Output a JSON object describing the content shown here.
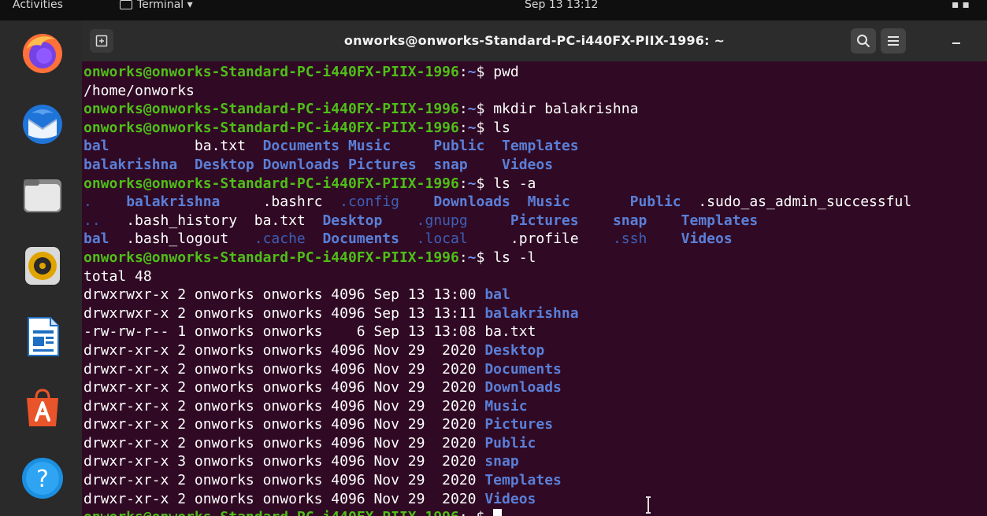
{
  "topbar": {
    "activities": "Activities",
    "app_name": "Terminal ▾",
    "clock": "Sep 13  13:12"
  },
  "window": {
    "title": "onworks@onworks-Standard-PC-i440FX-PIIX-1996: ~"
  },
  "dock": {
    "items": [
      "firefox",
      "thunderbird",
      "files",
      "rhythmbox",
      "libreoffice-writer",
      "software",
      "help"
    ]
  },
  "colors": {
    "terminal_bg": "#300a24",
    "prompt": "#4fbe18",
    "directory": "#5a7fd8",
    "header_bg": "#2c2c2c",
    "dock_bg": "#2a2a2a"
  },
  "terminal": {
    "prompt_user": "onworks@onworks-Standard-PC-i440FX-PIIX-1996",
    "prompt_sep": ":",
    "prompt_path": "~",
    "prompt_dollar": "$",
    "lines": [
      {
        "kind": "prompt",
        "cmd": " pwd"
      },
      {
        "kind": "out",
        "text": "/home/onworks"
      },
      {
        "kind": "prompt",
        "cmd": " mkdir balakrishna"
      },
      {
        "kind": "prompt",
        "cmd": " ls"
      },
      {
        "kind": "cols",
        "cells": [
          {
            "t": "bal          ",
            "c": "dir"
          },
          {
            "t": "ba.txt  ",
            "c": "file"
          },
          {
            "t": "Documents ",
            "c": "dir"
          },
          {
            "t": "Music     ",
            "c": "dir"
          },
          {
            "t": "Public  ",
            "c": "dir"
          },
          {
            "t": "Templates",
            "c": "dir"
          }
        ]
      },
      {
        "kind": "cols",
        "cells": [
          {
            "t": "balakrishna  ",
            "c": "dir"
          },
          {
            "t": "Desktop ",
            "c": "dir"
          },
          {
            "t": "Downloads ",
            "c": "dir"
          },
          {
            "t": "Pictures  ",
            "c": "dir"
          },
          {
            "t": "snap    ",
            "c": "dir"
          },
          {
            "t": "Videos",
            "c": "dir"
          }
        ]
      },
      {
        "kind": "prompt",
        "cmd": " ls -a"
      },
      {
        "kind": "cols",
        "cells": [
          {
            "t": ".    ",
            "c": "dotdir"
          },
          {
            "t": "balakrishna     ",
            "c": "dir"
          },
          {
            "t": ".bashrc  ",
            "c": "file"
          },
          {
            "t": ".config    ",
            "c": "dotdir"
          },
          {
            "t": "Downloads  ",
            "c": "dir"
          },
          {
            "t": "Music       ",
            "c": "dir"
          },
          {
            "t": "Public  ",
            "c": "dir"
          },
          {
            "t": ".sudo_as_admin_successful",
            "c": "file"
          }
        ]
      },
      {
        "kind": "cols",
        "cells": [
          {
            "t": "..   ",
            "c": "dotdir"
          },
          {
            "t": ".bash_history  ",
            "c": "file"
          },
          {
            "t": "ba.txt  ",
            "c": "file"
          },
          {
            "t": "Desktop    ",
            "c": "dir"
          },
          {
            "t": ".gnupg     ",
            "c": "dotdir"
          },
          {
            "t": "Pictures    ",
            "c": "dir"
          },
          {
            "t": "snap    ",
            "c": "dir"
          },
          {
            "t": "Templates",
            "c": "dir"
          }
        ]
      },
      {
        "kind": "cols",
        "cells": [
          {
            "t": "bal  ",
            "c": "dir"
          },
          {
            "t": ".bash_logout   ",
            "c": "file"
          },
          {
            "t": ".cache  ",
            "c": "dotdir"
          },
          {
            "t": "Documents  ",
            "c": "dir"
          },
          {
            "t": ".local     ",
            "c": "dotdir"
          },
          {
            "t": ".profile    ",
            "c": "file"
          },
          {
            "t": ".ssh    ",
            "c": "dotdir"
          },
          {
            "t": "Videos",
            "c": "dir"
          }
        ]
      },
      {
        "kind": "prompt",
        "cmd": " ls -l"
      },
      {
        "kind": "out",
        "text": "total 48"
      },
      {
        "kind": "ll",
        "meta": "drwxrwxr-x 2 onworks onworks 4096 Sep 13 13:00 ",
        "name": "bal",
        "c": "dir"
      },
      {
        "kind": "ll",
        "meta": "drwxrwxr-x 2 onworks onworks 4096 Sep 13 13:11 ",
        "name": "balakrishna",
        "c": "dir"
      },
      {
        "kind": "ll",
        "meta": "-rw-rw-r-- 1 onworks onworks    6 Sep 13 13:08 ",
        "name": "ba.txt",
        "c": "file"
      },
      {
        "kind": "ll",
        "meta": "drwxr-xr-x 2 onworks onworks 4096 Nov 29  2020 ",
        "name": "Desktop",
        "c": "dir"
      },
      {
        "kind": "ll",
        "meta": "drwxr-xr-x 2 onworks onworks 4096 Nov 29  2020 ",
        "name": "Documents",
        "c": "dir"
      },
      {
        "kind": "ll",
        "meta": "drwxr-xr-x 2 onworks onworks 4096 Nov 29  2020 ",
        "name": "Downloads",
        "c": "dir"
      },
      {
        "kind": "ll",
        "meta": "drwxr-xr-x 2 onworks onworks 4096 Nov 29  2020 ",
        "name": "Music",
        "c": "dir"
      },
      {
        "kind": "ll",
        "meta": "drwxr-xr-x 2 onworks onworks 4096 Nov 29  2020 ",
        "name": "Pictures",
        "c": "dir"
      },
      {
        "kind": "ll",
        "meta": "drwxr-xr-x 2 onworks onworks 4096 Nov 29  2020 ",
        "name": "Public",
        "c": "dir"
      },
      {
        "kind": "ll",
        "meta": "drwxr-xr-x 3 onworks onworks 4096 Nov 29  2020 ",
        "name": "snap",
        "c": "dir"
      },
      {
        "kind": "ll",
        "meta": "drwxr-xr-x 2 onworks onworks 4096 Nov 29  2020 ",
        "name": "Templates",
        "c": "dir"
      },
      {
        "kind": "ll",
        "meta": "drwxr-xr-x 2 onworks onworks 4096 Nov 29  2020 ",
        "name": "Videos",
        "c": "dir"
      },
      {
        "kind": "prompt",
        "cmd": " ",
        "cursor": true
      }
    ]
  }
}
